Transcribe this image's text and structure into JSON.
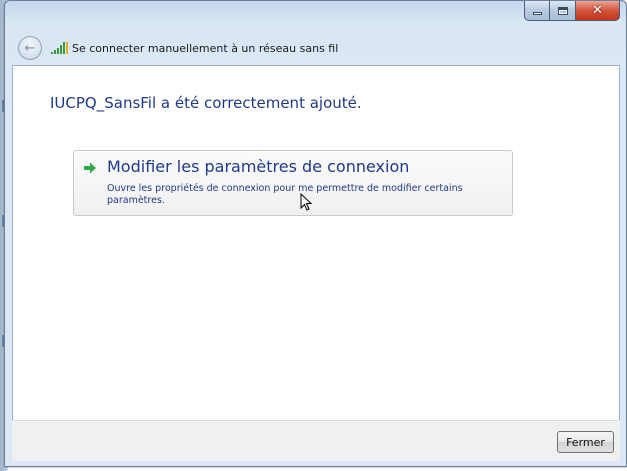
{
  "window": {
    "title": "Se connecter manuellement à un réseau sans fil",
    "caption": {
      "minimize_icon": "minimize-icon",
      "maximize_icon": "maximize-icon",
      "close_icon": "close-icon"
    }
  },
  "main": {
    "heading": "IUCPQ_SansFil a été correctement ajouté.",
    "command_link": {
      "title": "Modifier les paramètres de connexion",
      "description": "Ouvre les propriétés de connexion pour me permettre de modifier certains paramètres."
    }
  },
  "footer": {
    "close_label": "Fermer"
  },
  "colors": {
    "link_blue": "#1e3a8a",
    "arrow_green": "#2ea84a",
    "close_red": "#c2351b"
  }
}
